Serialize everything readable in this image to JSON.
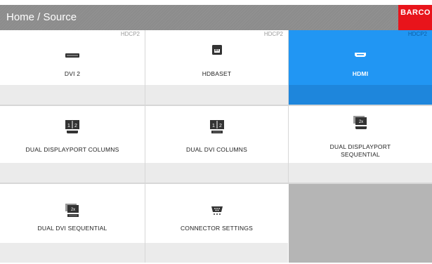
{
  "header": {
    "title": "Home / Source",
    "brand": "BARCO"
  },
  "tiles": [
    {
      "label": "DVI 2",
      "hdcp": "HDCP2",
      "icon": "dvi-connector-icon"
    },
    {
      "label": "HDBASET",
      "hdcp": "HDCP2",
      "icon": "rj45-connector-icon"
    },
    {
      "label": "HDMI",
      "hdcp": "HDCP2",
      "icon": "hdmi-connector-icon"
    },
    {
      "label": "DUAL DISPLAYPORT COLUMNS",
      "icon": "dual-displayport-columns-icon"
    },
    {
      "label": "DUAL DVI COLUMNS",
      "icon": "dual-dvi-columns-icon"
    },
    {
      "label": "DUAL DISPLAYPORT SEQUENTIAL",
      "icon": "dual-displayport-sequential-icon"
    },
    {
      "label": "DUAL DVI SEQUENTIAL",
      "icon": "dual-dvi-sequential-icon"
    },
    {
      "label": "CONNECTOR SETTINGS",
      "icon": "connector-settings-icon"
    }
  ],
  "icon_text": {
    "col1": "1",
    "col2": "2",
    "seq": "2x"
  },
  "colors": {
    "header": "#8c8c8c",
    "brand": "#e8141b",
    "selected": "#2196f3"
  }
}
